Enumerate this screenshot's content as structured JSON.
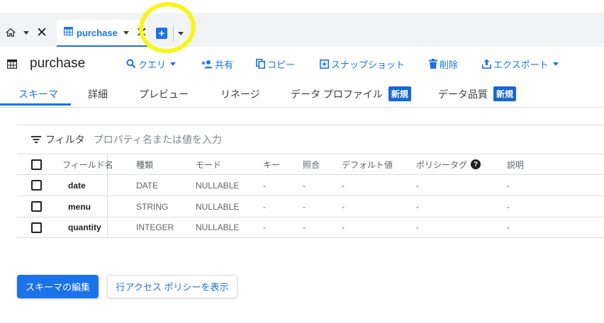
{
  "tabs": {
    "home_icon": "home-icon",
    "active_tab_label": "purchase",
    "active_tab_icon": "table-icon",
    "new_tab_icon": "plus-box-icon"
  },
  "header": {
    "title": "purchase",
    "toolbar": {
      "query": "クエリ",
      "share": "共有",
      "copy": "コピー",
      "snapshot": "スナップショット",
      "delete": "削除",
      "export": "エクスポート"
    }
  },
  "subtabs": {
    "schema": "スキーマ",
    "details": "詳細",
    "preview": "プレビュー",
    "lineage": "リネージ",
    "data_profile": "データ プロファイル",
    "data_quality": "データ品質",
    "new_badge": "新規"
  },
  "filter": {
    "label": "フィルタ",
    "placeholder": "プロパティ名または値を入力"
  },
  "table": {
    "headers": {
      "field_name": "フィールド名",
      "type": "種類",
      "mode": "モード",
      "key": "キー",
      "collation": "照合",
      "default_value": "デフォルト値",
      "policy_tag": "ポリシータグ",
      "description": "説明"
    },
    "rows": [
      {
        "name": "date",
        "type": "DATE",
        "mode": "NULLABLE",
        "key": "-",
        "collation": "-",
        "default": "-",
        "policy": "-",
        "description": "-"
      },
      {
        "name": "menu",
        "type": "STRING",
        "mode": "NULLABLE",
        "key": "-",
        "collation": "-",
        "default": "-",
        "policy": "-",
        "description": "-"
      },
      {
        "name": "quantity",
        "type": "INTEGER",
        "mode": "NULLABLE",
        "key": "-",
        "collation": "-",
        "default": "-",
        "policy": "-",
        "description": "-"
      }
    ]
  },
  "buttons": {
    "edit_schema": "スキーマの編集",
    "row_access_policy": "行アクセス ポリシーを表示"
  },
  "colors": {
    "accent": "#1a73e8",
    "highlight": "#f8f51a"
  }
}
